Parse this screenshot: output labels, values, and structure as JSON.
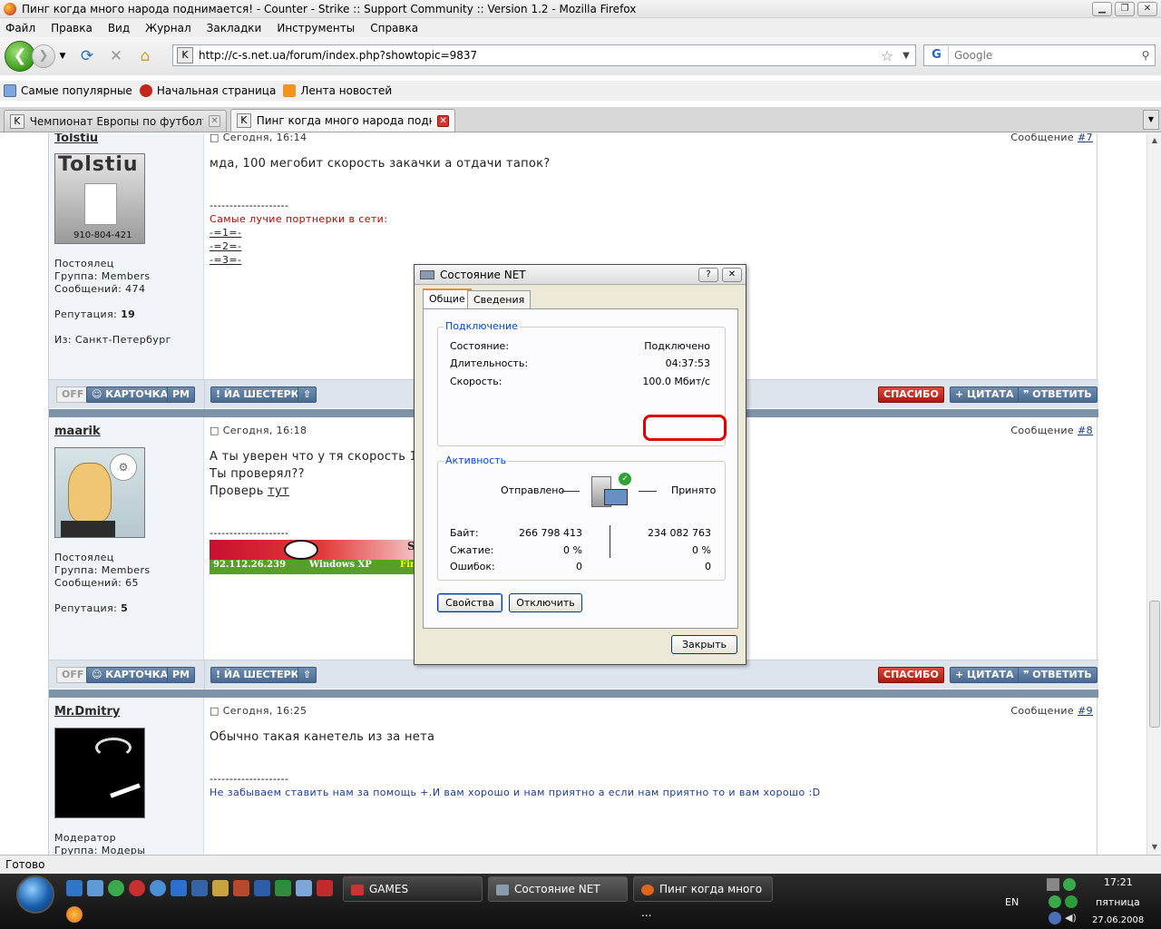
{
  "window": {
    "title": "Пинг когда много народа поднимается! - Counter - Strike :: Support Community :: Version 1.2 - Mozilla Firefox"
  },
  "menu": [
    "Файл",
    "Правка",
    "Вид",
    "Журнал",
    "Закладки",
    "Инструменты",
    "Справка"
  ],
  "nav": {
    "url": "http://c-s.net.ua/forum/index.php?showtopic=9837",
    "search_placeholder": "Google"
  },
  "bookmarks": [
    "Самые популярные",
    "Начальная страница",
    "Лента новостей"
  ],
  "tabs": [
    {
      "label": "Чемпионат Европы по футболу 20...",
      "active": false
    },
    {
      "label": "Пинг когда много народа подни...",
      "active": true
    }
  ],
  "posts": [
    {
      "user": "Tolstiu",
      "date": "Сегодня, 16:14",
      "msg_label": "Сообщение",
      "msg_num": "#7",
      "avatar_title": "Tolstiu",
      "avatar_caption": "910-804-421",
      "info": [
        "Постоялец",
        "Группа: Members",
        "Сообщений: 474"
      ],
      "rep_label": "Репутация:",
      "rep": "19",
      "from": "Из: Санкт-Петербург",
      "text": "мда, 100 мегобит скорость закачки а отдачи тапок?",
      "sig_line": "--------------------",
      "sig_title": "Самые лучие портнерки в сети:",
      "sig_links": [
        "-=1=-",
        "-=2=-",
        "-=3=-"
      ]
    },
    {
      "user": "maarik",
      "date": "Сегодня, 16:18",
      "msg_label": "Сообщение",
      "msg_num": "#8",
      "info": [
        "Постоялец",
        "Группа: Members",
        "Сообщений: 65"
      ],
      "rep_label": "Репутация:",
      "rep": "5",
      "text_lines": [
        "А ты уверен что у тя скорость 100м",
        "Ты проверял??"
      ],
      "text_check": "Проверь",
      "text_link": "тут",
      "sig_line": "--------------------",
      "banner_ip": "92.112.26.239",
      "banner_os": "Windows XP",
      "banner_s": "S",
      "banner_tail": "Fir"
    },
    {
      "user": "Mr.Dmitry",
      "date": "Сегодня, 16:25",
      "msg_label": "Сообщение",
      "msg_num": "#9",
      "info": [
        "Модератор",
        "Группа: Модеры"
      ],
      "text": "Обычно такая канетель из за нета",
      "sig_line": "--------------------",
      "sig_text": "Не забываем ставить нам за помощь +.И вам хорошо и нам приятно а если нам приятно то и вам хорошо :D"
    }
  ],
  "buttons": {
    "off": "OFF",
    "card": "КАРТОЧКА",
    "pm": "PM",
    "report": "ЙА ШЕСТЕРКО",
    "up": "⇧",
    "thanks": "СПАСИБО",
    "quote": "ЦИТАТА",
    "reply": "ОТВЕТИТЬ"
  },
  "dialog": {
    "title": "Состояние NET",
    "help": "?",
    "close_x": "✕",
    "tabs": [
      "Общие",
      "Сведения"
    ],
    "connection_label": "Подключение",
    "status_label": "Состояние:",
    "status_value": "Подключено",
    "duration_label": "Длительность:",
    "duration_value": "04:37:53",
    "speed_label": "Скорость:",
    "speed_value": "100.0 Мбит/с",
    "activity_label": "Активность",
    "sent_label": "Отправлено",
    "received_label": "Принято",
    "bytes_label": "Байт:",
    "bytes_sent": "266 798 413",
    "bytes_received": "234 082 763",
    "compression_label": "Сжатие:",
    "compression_sent": "0 %",
    "compression_received": "0 %",
    "errors_label": "Ошибок:",
    "errors_sent": "0",
    "errors_received": "0",
    "properties_btn": "Свойства",
    "disconnect_btn": "Отключить",
    "close_btn": "Закрыть"
  },
  "statusbar": "Готово",
  "taskbar": {
    "tasks": [
      "GAMES",
      "Состояние NET",
      "Пинг когда много ..."
    ],
    "lang": "EN",
    "time": "17:21",
    "day": "пятница",
    "date": "27.06.2008"
  },
  "colors": {
    "forum_header": "#7f93a8",
    "button_red": "#c0281a",
    "highlight": "#e00000"
  }
}
